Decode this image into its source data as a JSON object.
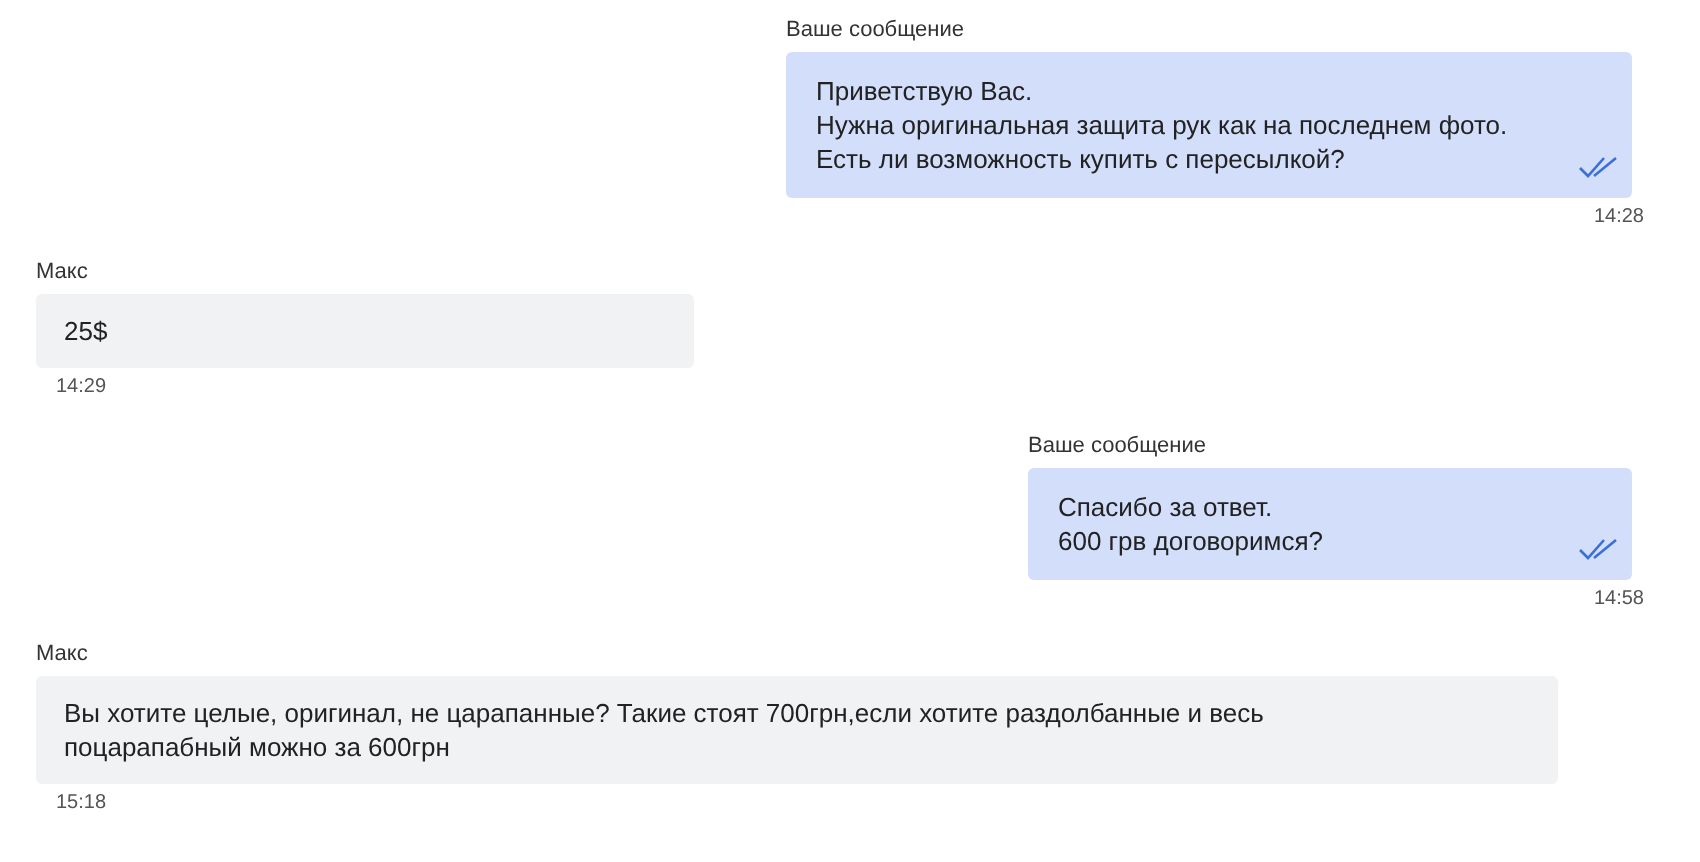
{
  "messages": [
    {
      "kind": "outgoing",
      "sender": "Ваше сообщение",
      "lines": [
        "Приветствую Вас.",
        "Нужна оригинальная защита рук как на последнем фото.",
        "Есть ли возможность купить с пересылкой?"
      ],
      "read": true,
      "time": "14:28"
    },
    {
      "kind": "incoming",
      "sender": "Макс",
      "lines": [
        "25$"
      ],
      "time": "14:29"
    },
    {
      "kind": "outgoing",
      "sender": "Ваше сообщение",
      "lines": [
        "Спасибо за ответ.",
        "600 грв договоримся?"
      ],
      "read": true,
      "time": "14:58"
    },
    {
      "kind": "incoming",
      "sender": "Макс",
      "lines": [
        "Вы хотите целые, оригинал, не царапанные? Такие стоят 700грн,если хотите раздолбанные и весь",
        "поцарапабный можно за 600грн"
      ],
      "time": "15:18"
    }
  ]
}
